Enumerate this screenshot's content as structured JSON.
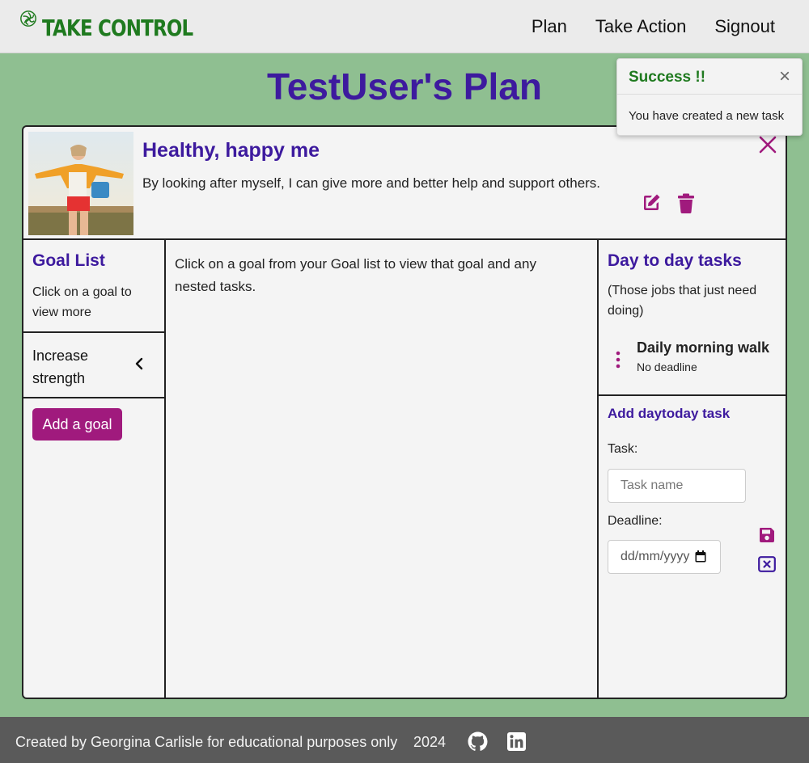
{
  "app": {
    "brand": "TAKE CONTROL",
    "brand_color": "#1f7a1f",
    "accent_color": "#3d1a9e",
    "button_color": "#a01a7d",
    "page_background": "#8fbf91"
  },
  "nav": {
    "items": [
      {
        "label": "Plan"
      },
      {
        "label": "Take Action"
      },
      {
        "label": "Signout"
      }
    ]
  },
  "page": {
    "title": "TestUser's Plan"
  },
  "toast": {
    "title": "Success !!",
    "close_symbol": "×",
    "message": "You have created a new task"
  },
  "plan": {
    "title": "Healthy, happy me",
    "description": "By looking after myself, I can give more and better help and support others.",
    "icons": [
      "close-icon",
      "edit-icon",
      "trash-icon"
    ]
  },
  "goals": {
    "heading": "Goal List",
    "subtext": "Click on a goal to view more",
    "items": [
      {
        "label": "Increase strength"
      }
    ],
    "add_button": "Add a goal"
  },
  "main": {
    "message": "Click on a goal from your Goal list to view that goal and any nested tasks."
  },
  "daytoday": {
    "heading": "Day to day tasks",
    "subtext": "(Those jobs that just need doing)",
    "tasks": [
      {
        "name": "Daily morning walk",
        "deadline": "No deadline"
      }
    ],
    "form": {
      "heading": "Add daytoday task",
      "task_label": "Task:",
      "task_placeholder": "Task name",
      "deadline_label": "Deadline:",
      "deadline_placeholder": "dd/mm/yyyy"
    }
  },
  "footer": {
    "text": "Created by Georgina Carlisle for educational purposes only",
    "year": "2024",
    "icons": [
      "github-icon",
      "linkedin-icon"
    ]
  }
}
